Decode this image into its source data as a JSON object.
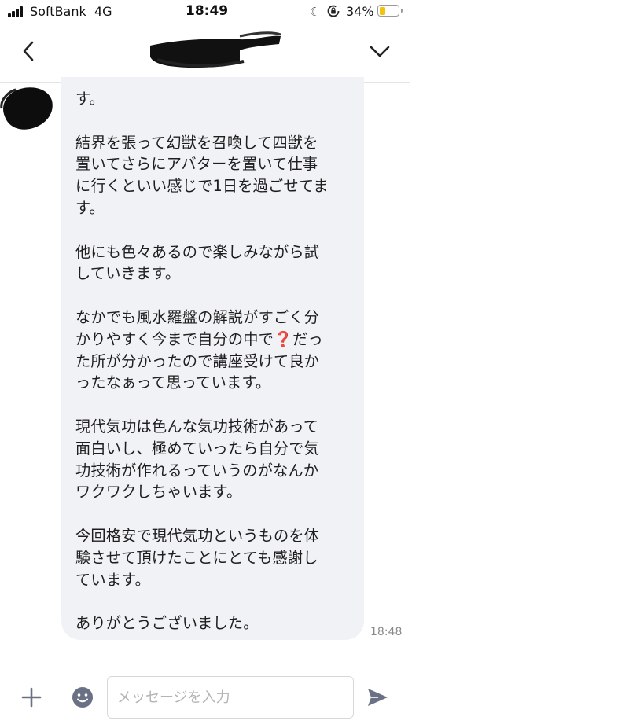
{
  "status_bar": {
    "carrier": "SoftBank",
    "network": "4G",
    "time": "18:49",
    "battery_percent": "34%",
    "battery_level": 0.34,
    "battery_color": "#f2c30f"
  },
  "header": {
    "icons": [
      "chevron-left-icon",
      "chevron-down-icon"
    ]
  },
  "message": {
    "lines": [
      "す。",
      "",
      "結界を張って幻獣を召喚して四獣を",
      "置いてさらにアバターを置いて仕事",
      "に行くといい感じで1日を過ごせてま",
      "す。",
      "",
      "他にも色々あるので楽しみながら試",
      "していきます。",
      "",
      "なかでも風水羅盤の解説がすごく分",
      "かりやすく今まで自分の中で",
      "だっ",
      "た所が分かったので講座受けて良か",
      "ったなぁって思っています。",
      "",
      "現代気功は色んな気功技術があって",
      "面白いし、極めていったら自分で気",
      "功技術が作れるっていうのがなんか",
      "ワクワクしちゃいます。",
      "",
      "今回格安で現代気功というものを体",
      "験させて頂けたことにとても感謝し",
      "ています。",
      "",
      "ありがとうございました。"
    ],
    "emoji": "❓",
    "time": "18:48",
    "bubble_color": "#f1f2f5"
  },
  "input_bar": {
    "placeholder": "メッセージを入力",
    "value": "",
    "icons": [
      "plus-icon",
      "emoji-icon",
      "send-icon"
    ],
    "accent": "#6b7184"
  }
}
